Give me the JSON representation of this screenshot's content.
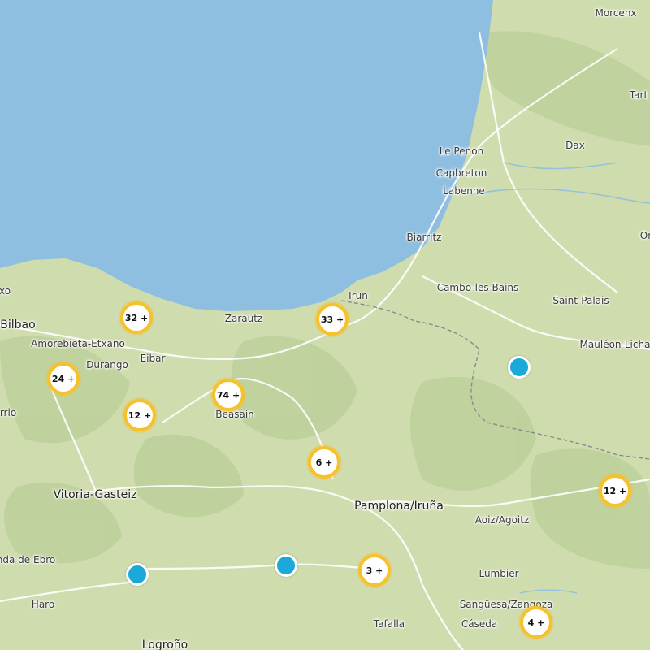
{
  "map": {
    "places": [
      {
        "id": "morcenx",
        "name": "Morcenx"
      },
      {
        "id": "tart",
        "name": "Tart"
      },
      {
        "id": "dax",
        "name": "Dax"
      },
      {
        "id": "le-penon",
        "name": "Le Penon"
      },
      {
        "id": "capbreton",
        "name": "Capbreton"
      },
      {
        "id": "labenne",
        "name": "Labenne"
      },
      {
        "id": "biarritz",
        "name": "Biarritz"
      },
      {
        "id": "or",
        "name": "Or"
      },
      {
        "id": "irun",
        "name": "Irun"
      },
      {
        "id": "cambo",
        "name": "Cambo-les-Bains"
      },
      {
        "id": "saint-palais",
        "name": "Saint-Palais"
      },
      {
        "id": "mauleon",
        "name": "Mauléon-Licha"
      },
      {
        "id": "xo",
        "name": "xo"
      },
      {
        "id": "bilbao",
        "name": "Bilbao"
      },
      {
        "id": "zarautz",
        "name": "Zarautz"
      },
      {
        "id": "amorebieta",
        "name": "Amorebieta-Etxano"
      },
      {
        "id": "eibar",
        "name": "Eibar"
      },
      {
        "id": "durango",
        "name": "Durango"
      },
      {
        "id": "rrio",
        "name": "rrio"
      },
      {
        "id": "beasain",
        "name": "Beasain"
      },
      {
        "id": "vitoria",
        "name": "Vitoria-Gasteiz"
      },
      {
        "id": "pamplona",
        "name": "Pamplona/Iruña"
      },
      {
        "id": "aoiz",
        "name": "Aoiz/Agoitz"
      },
      {
        "id": "miranda",
        "name": "nda de Ebro"
      },
      {
        "id": "lumbier",
        "name": "Lumbier"
      },
      {
        "id": "haro",
        "name": "Haro"
      },
      {
        "id": "sanguesa",
        "name": "Sangüesa/Zangoza"
      },
      {
        "id": "tafalla",
        "name": "Tafalla"
      },
      {
        "id": "caseda",
        "name": "Cáseda"
      },
      {
        "id": "logrono",
        "name": "Logroño"
      }
    ],
    "clusters": [
      {
        "id": "c32",
        "label": "32 +",
        "count": 32
      },
      {
        "id": "c33",
        "label": "33 +",
        "count": 33
      },
      {
        "id": "c24",
        "label": "24 +",
        "count": 24
      },
      {
        "id": "c74",
        "label": "74 +",
        "count": 74
      },
      {
        "id": "c12a",
        "label": "12 +",
        "count": 12
      },
      {
        "id": "c6",
        "label": "6 +",
        "count": 6
      },
      {
        "id": "c12b",
        "label": "12 +",
        "count": 12
      },
      {
        "id": "c3",
        "label": "3 +",
        "count": 3
      },
      {
        "id": "c4",
        "label": "4 +",
        "count": 4
      }
    ],
    "pins": [
      {
        "id": "pin-east"
      },
      {
        "id": "pin-west"
      },
      {
        "id": "pin-center"
      }
    ],
    "colors": {
      "sea": "#8fbfe0",
      "land": "#cfdcae",
      "cluster_ring": "#f5c12d",
      "pin": "#1aa9d8"
    }
  }
}
